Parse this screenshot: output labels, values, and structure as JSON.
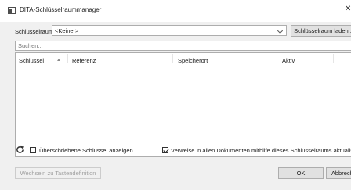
{
  "window": {
    "title": "DITA-Schlüsselraummanager",
    "icon": "app-window-icon",
    "close_icon": "close-icon"
  },
  "keyspace": {
    "label": "Schlüsselraum:",
    "selected": "<Keiner>",
    "load_button": "Schlüsselraum laden..."
  },
  "search": {
    "placeholder": "Suchen..."
  },
  "table": {
    "columns": [
      "Schlüssel",
      "Referenz",
      "Speicherort",
      "Aktiv"
    ],
    "sort_column": "Schlüssel",
    "sort_direction": "ascending",
    "rows": []
  },
  "options": {
    "refresh_icon": "refresh-icon",
    "show_overwritten": {
      "label": "Überschriebene Schlüssel anzeigen",
      "checked": false
    },
    "refer_keys": {
      "label": "Verweise in allen Dokumenten mithilfe dieses Schlüsselraums aktualisieren",
      "checked": true
    }
  },
  "footer": {
    "switch_button": "Wechseln zu Tastendefinition",
    "ok_button": "OK",
    "cancel_button": "Abbrechen"
  }
}
